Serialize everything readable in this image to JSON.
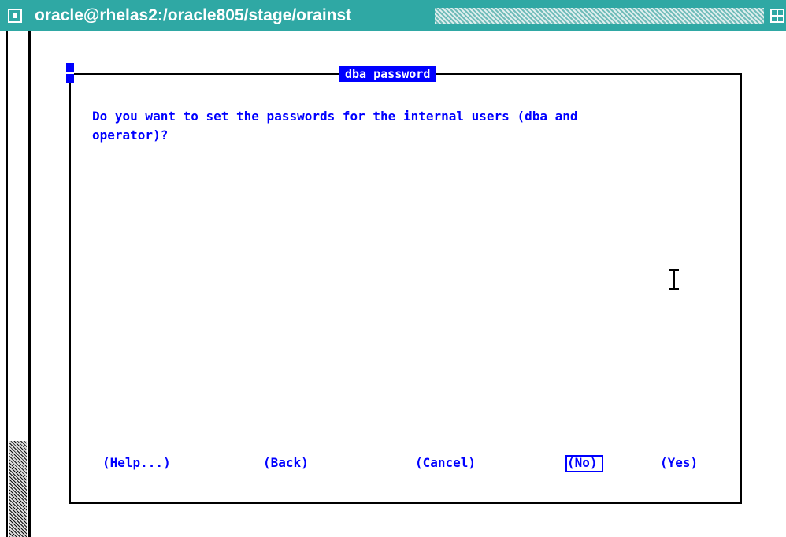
{
  "window": {
    "title": "oracle@rhelas2:/oracle805/stage/orainst",
    "menu_icon": "window-menu-icon",
    "maximize_icon": "maximize-icon"
  },
  "dialog": {
    "title": "dba password",
    "prompt": "Do you want to set the passwords for the internal users (dba and\noperator)?",
    "buttons": {
      "help": "(Help...)",
      "back": "(Back)",
      "cancel": "(Cancel)",
      "no": "(No)",
      "yes": "(Yes)"
    },
    "focused_button": "no"
  },
  "colors": {
    "titlebar": "#2fa8a4",
    "dialog_text": "#0000ff",
    "background": "#ffffff"
  },
  "cursor": "text-cursor-icon"
}
